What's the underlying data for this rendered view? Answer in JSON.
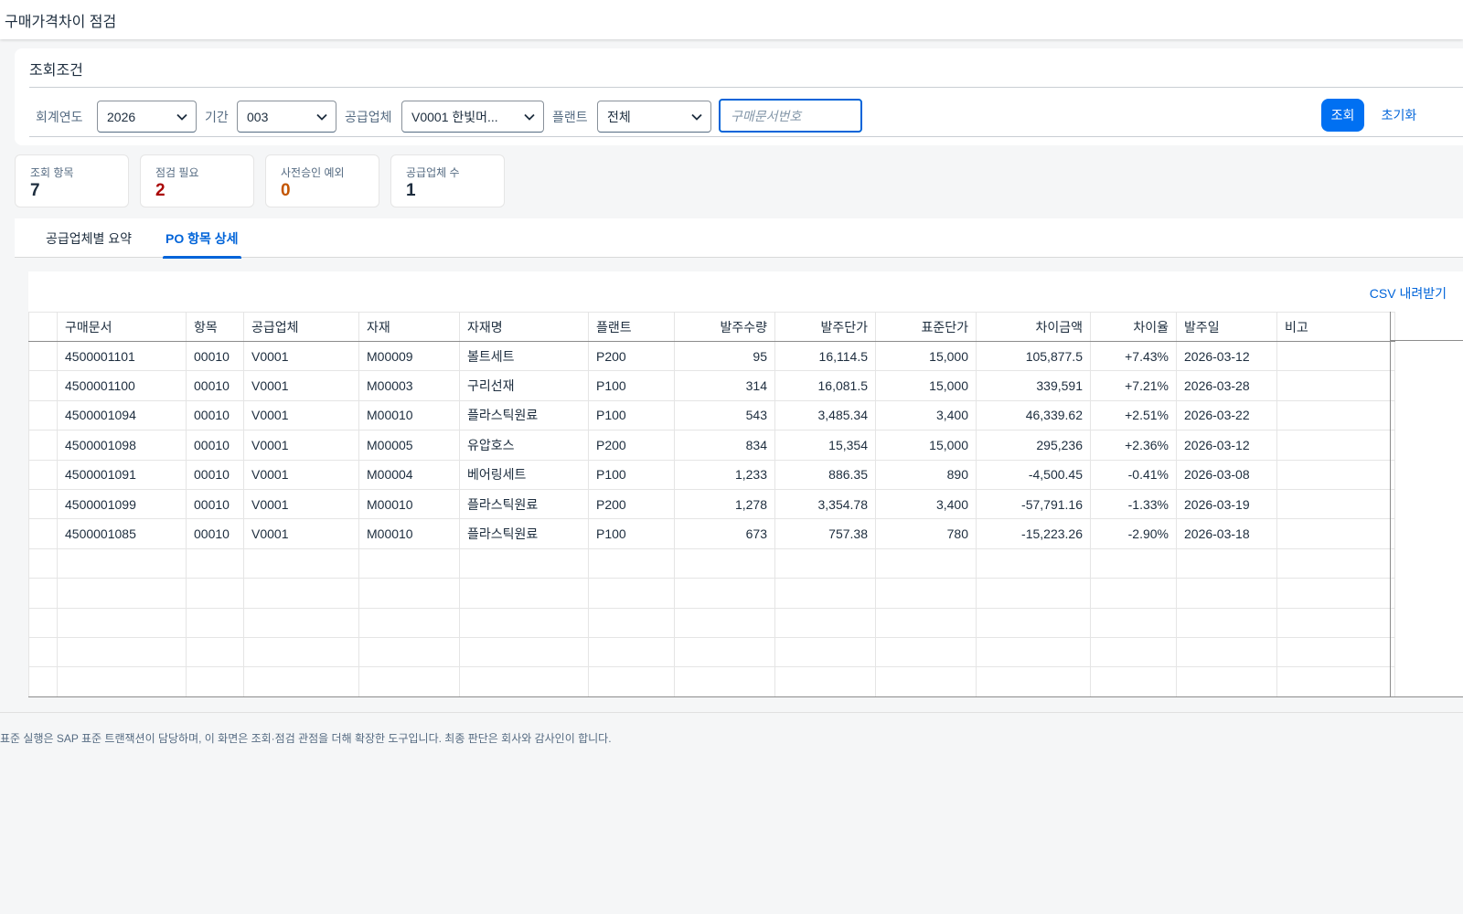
{
  "header": {
    "title": "구매가격차이 점검"
  },
  "filters": {
    "title": "조회조건",
    "fiscal_year": {
      "label": "회계연도",
      "value": "2026"
    },
    "period": {
      "label": "기간",
      "value": "003"
    },
    "vendor": {
      "label": "공급업체",
      "value": "V0001 한빛머..."
    },
    "plant": {
      "label": "플랜트",
      "value": "전체"
    },
    "po_search": {
      "placeholder": "구매문서번호",
      "value": ""
    },
    "search_button": "조회",
    "reset_button": "초기화"
  },
  "kpis": {
    "items_count": {
      "label": "조회 항목",
      "value": "7",
      "color": "#1d2d3e"
    },
    "needs_check": {
      "label": "점검 필요",
      "value": "2",
      "color": "#aa0808"
    },
    "pre_approved": {
      "label": "사전승인 예외",
      "value": "0",
      "color": "#c35500"
    },
    "vendor_count": {
      "label": "공급업체 수",
      "value": "1",
      "color": "#1d2d3e"
    }
  },
  "tabs": {
    "summary": "공급업체별 요약",
    "detail": "PO 항목 상세",
    "active": "detail"
  },
  "table": {
    "csv_label": "CSV 내려받기",
    "columns": {
      "po": "구매문서",
      "item": "항목",
      "vendor": "공급업체",
      "material": "자재",
      "material_name": "자재명",
      "plant": "플랜트",
      "qty": "발주수량",
      "po_price": "발주단가",
      "std_price": "표준단가",
      "diff_amount": "차이금액",
      "diff_rate": "차이율",
      "po_date": "발주일",
      "remark": "비고"
    },
    "rows": [
      {
        "po": "4500001101",
        "item": "00010",
        "vendor": "V0001",
        "material": "M00009",
        "material_name": "볼트세트",
        "plant": "P200",
        "qty": "95",
        "po_price": "16,114.5",
        "std_price": "15,000",
        "diff_amount": "105,877.5",
        "diff_rate": "+7.43%",
        "po_date": "2026-03-12",
        "remark": ""
      },
      {
        "po": "4500001100",
        "item": "00010",
        "vendor": "V0001",
        "material": "M00003",
        "material_name": "구리선재",
        "plant": "P100",
        "qty": "314",
        "po_price": "16,081.5",
        "std_price": "15,000",
        "diff_amount": "339,591",
        "diff_rate": "+7.21%",
        "po_date": "2026-03-28",
        "remark": ""
      },
      {
        "po": "4500001094",
        "item": "00010",
        "vendor": "V0001",
        "material": "M00010",
        "material_name": "플라스틱원료",
        "plant": "P100",
        "qty": "543",
        "po_price": "3,485.34",
        "std_price": "3,400",
        "diff_amount": "46,339.62",
        "diff_rate": "+2.51%",
        "po_date": "2026-03-22",
        "remark": ""
      },
      {
        "po": "4500001098",
        "item": "00010",
        "vendor": "V0001",
        "material": "M00005",
        "material_name": "유압호스",
        "plant": "P200",
        "qty": "834",
        "po_price": "15,354",
        "std_price": "15,000",
        "diff_amount": "295,236",
        "diff_rate": "+2.36%",
        "po_date": "2026-03-12",
        "remark": ""
      },
      {
        "po": "4500001091",
        "item": "00010",
        "vendor": "V0001",
        "material": "M00004",
        "material_name": "베어링세트",
        "plant": "P100",
        "qty": "1,233",
        "po_price": "886.35",
        "std_price": "890",
        "diff_amount": "-4,500.45",
        "diff_rate": "-0.41%",
        "po_date": "2026-03-08",
        "remark": ""
      },
      {
        "po": "4500001099",
        "item": "00010",
        "vendor": "V0001",
        "material": "M00010",
        "material_name": "플라스틱원료",
        "plant": "P200",
        "qty": "1,278",
        "po_price": "3,354.78",
        "std_price": "3,400",
        "diff_amount": "-57,791.16",
        "diff_rate": "-1.33%",
        "po_date": "2026-03-19",
        "remark": ""
      },
      {
        "po": "4500001085",
        "item": "00010",
        "vendor": "V0001",
        "material": "M00010",
        "material_name": "플라스틱원료",
        "plant": "P100",
        "qty": "673",
        "po_price": "757.38",
        "std_price": "780",
        "diff_amount": "-15,223.26",
        "diff_rate": "-2.90%",
        "po_date": "2026-03-18",
        "remark": ""
      }
    ]
  },
  "footer": {
    "note": "표준 실행은 SAP 표준 트랜잭션이 담당하며, 이 화면은 조회·점검 관점을 더해 확장한 도구입니다. 최종 판단은 회사와 감사인이 합니다."
  },
  "icons": {
    "dropdown": "chevron-down-icon"
  }
}
